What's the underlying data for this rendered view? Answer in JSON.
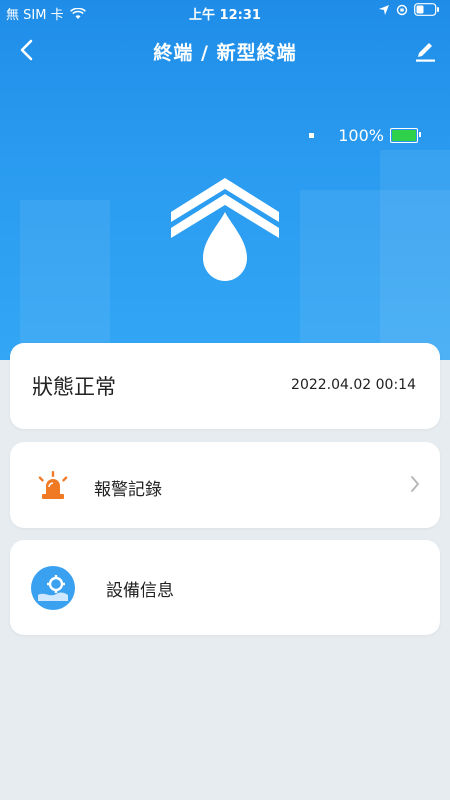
{
  "status_bar": {
    "carrier": "無 SIM 卡",
    "time": "上午 12:31"
  },
  "nav": {
    "title": "終端 / 新型終端"
  },
  "device": {
    "battery": "100%"
  },
  "status_card": {
    "text": "狀態正常",
    "timestamp": "2022.04.02 00:14"
  },
  "menu": {
    "alarm_label": "報警記錄",
    "device_label": "設備信息"
  },
  "colors": {
    "header_blue": "#1f8de8",
    "battery_green": "#2fd04a",
    "alarm_orange": "#f07a23",
    "device_blue": "#3aa0f0"
  }
}
